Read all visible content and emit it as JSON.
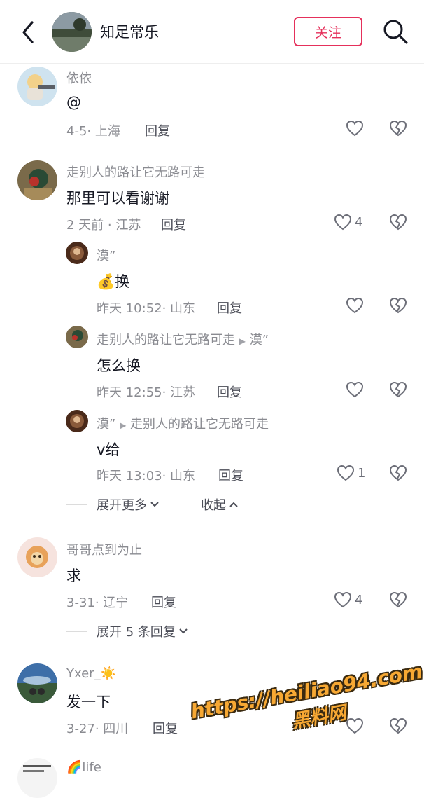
{
  "header": {
    "title": "知足常乐",
    "follow_label": "关注"
  },
  "comments": [
    {
      "user": "依依",
      "text": "@",
      "meta": "4-5· 上海",
      "reply": "回复",
      "likes": ""
    },
    {
      "user": "走别人的路让它无路可走",
      "text": "那里可以看谢谢",
      "meta": "2 天前 · 江苏",
      "reply": "回复",
      "likes": "4",
      "replies": [
        {
          "user": "漠”",
          "text": "换",
          "emoji": "💰",
          "meta": "昨天 10:52· 山东",
          "reply": "回复",
          "likes": ""
        },
        {
          "user": "走别人的路让它无路可走",
          "reply_to": "漠”",
          "text": "怎么换",
          "meta": "昨天 12:55· 江苏",
          "reply": "回复",
          "likes": ""
        },
        {
          "user": "漠”",
          "reply_to": "走别人的路让它无路可走",
          "text": "v给",
          "meta": "昨天 13:03· 山东",
          "reply": "回复",
          "likes": "1"
        }
      ],
      "expand_more": "展开更多",
      "collapse": "收起"
    },
    {
      "user": "哥哥点到为止",
      "text": "求",
      "meta": "3-31· 辽宁",
      "reply": "回复",
      "likes": "4",
      "expand_replies": "展开 5 条回复"
    },
    {
      "user": "Yxer_",
      "user_emoji": "☀️",
      "text": "发一下",
      "meta": "3-27· 四川",
      "reply": "回复",
      "likes": ""
    },
    {
      "user": "life",
      "user_emoji": "🌈"
    }
  ],
  "watermark": {
    "url": "https://heiliao94.com",
    "name": "黑料网"
  },
  "icons": {
    "back": "chevron-left-icon",
    "search": "search-icon",
    "like": "heart-outline-icon",
    "dislike": "broken-heart-icon",
    "expand": "chevron-down-icon",
    "collapse": "chevron-up-icon",
    "reply_arrow": "triangle-right-icon"
  },
  "colors": {
    "accent": "#e5305b",
    "secondary_text": "#8a8b91",
    "primary_text": "#161823",
    "watermark": "#f7a833"
  }
}
